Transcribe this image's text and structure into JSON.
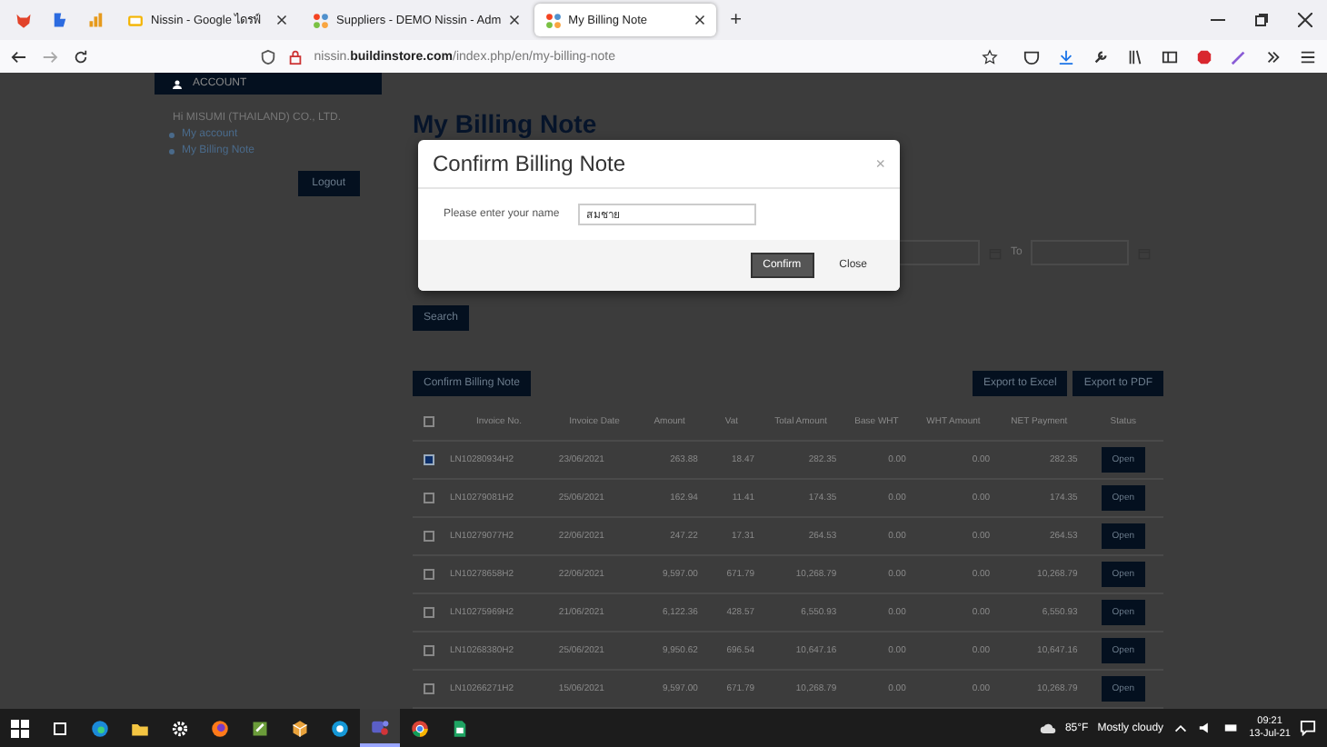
{
  "browser": {
    "tabs": [
      {
        "title": "Nissin - Google ไดรฟ์",
        "selected": false
      },
      {
        "title": "Suppliers - DEMO Nissin - Adm",
        "selected": false
      },
      {
        "title": "My Billing Note",
        "selected": true
      }
    ],
    "new_tab": "+",
    "url": "nissin.**buildinstore.com**/index.php/en/my-billing-note"
  },
  "sidebar": {
    "heading": "ACCOUNT",
    "greeting": "Hi MISUMI (THAILAND) CO., LTD.",
    "links": [
      "My account",
      "My Billing Note"
    ],
    "logout": "Logout"
  },
  "main": {
    "title": "My Billing Note",
    "to_label": "To",
    "search_button": "Search",
    "confirm_button": "Confirm Billing Note",
    "export_buttons": [
      "Export to Excel",
      "Export to PDF"
    ],
    "table": {
      "select_all_checked": false,
      "columns": [
        "Invoice No.",
        "Invoice Date",
        "Amount",
        "Vat",
        "Total Amount",
        "Base WHT",
        "WHT Amount",
        "NET Payment",
        "Status"
      ],
      "rows": [
        {
          "checked": true,
          "cells": [
            "LN10280934H2",
            "23/06/2021",
            "263.88",
            "18.47",
            "282.35",
            "0.00",
            "0.00",
            "282.35"
          ],
          "status": "Open"
        },
        {
          "checked": false,
          "cells": [
            "LN10279081H2",
            "25/06/2021",
            "162.94",
            "11.41",
            "174.35",
            "0.00",
            "0.00",
            "174.35"
          ],
          "status": "Open"
        },
        {
          "checked": false,
          "cells": [
            "LN10279077H2",
            "22/06/2021",
            "247.22",
            "17.31",
            "264.53",
            "0.00",
            "0.00",
            "264.53"
          ],
          "status": "Open"
        },
        {
          "checked": false,
          "cells": [
            "LN10278658H2",
            "22/06/2021",
            "9,597.00",
            "671.79",
            "10,268.79",
            "0.00",
            "0.00",
            "10,268.79"
          ],
          "status": "Open"
        },
        {
          "checked": false,
          "cells": [
            "LN10275969H2",
            "21/06/2021",
            "6,122.36",
            "428.57",
            "6,550.93",
            "0.00",
            "0.00",
            "6,550.93"
          ],
          "status": "Open"
        },
        {
          "checked": false,
          "cells": [
            "LN10268380H2",
            "25/06/2021",
            "9,950.62",
            "696.54",
            "10,647.16",
            "0.00",
            "0.00",
            "10,647.16"
          ],
          "status": "Open"
        },
        {
          "checked": false,
          "cells": [
            "LN10266271H2",
            "15/06/2021",
            "9,597.00",
            "671.79",
            "10,268.79",
            "0.00",
            "0.00",
            "10,268.79"
          ],
          "status": "Open"
        }
      ]
    }
  },
  "modal": {
    "title": "Confirm Billing Note",
    "close": "×",
    "label": "Please enter your name",
    "value": "สมชาย",
    "confirm": "Confirm",
    "cancel": "Close"
  },
  "taskbar": {
    "apps": [
      {
        "kind": "edge",
        "selected": false
      },
      {
        "kind": "folder",
        "selected": false
      },
      {
        "kind": "settings",
        "selected": false
      },
      {
        "kind": "firefox",
        "selected": false
      },
      {
        "kind": "notepad",
        "selected": false
      },
      {
        "kind": "box",
        "selected": false
      },
      {
        "kind": "skype",
        "selected": false
      },
      {
        "kind": "teams",
        "selected": true
      },
      {
        "kind": "chrome",
        "selected": false
      },
      {
        "kind": "sheet",
        "selected": false
      }
    ],
    "weather": "85°F",
    "condition": "Mostly cloudy",
    "time": "09:21",
    "date": "13-Jul-21"
  }
}
